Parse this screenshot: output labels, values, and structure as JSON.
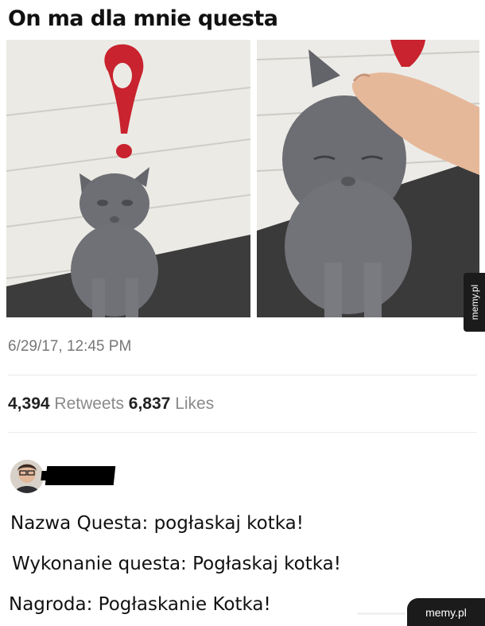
{
  "meme": {
    "title": "On ma dla mnie questa"
  },
  "photos": {
    "left_icon": "quest-exclamation-mark",
    "right_icon": "quest-exclamation-mark"
  },
  "tweet": {
    "timestamp": "6/29/17, 12:45 PM",
    "retweets_count": "4,394",
    "retweets_label": "Retweets",
    "likes_count": "6,837",
    "likes_label": "Likes"
  },
  "comment": {
    "lines": [
      "Nazwa Questa: pogłaskaj kotka!",
      "Wykonanie questa: Pogłaskaj kotka!",
      "Nagroda: Pogłaskanie Kotka!"
    ]
  },
  "watermarks": {
    "side": "memy.pl",
    "bottom": "memy.pl"
  },
  "colors": {
    "quest_marker": "#c8232e",
    "cat_fur": "#6e6f74",
    "wall": "#ecebe7",
    "ground": "#3a3a3a"
  }
}
